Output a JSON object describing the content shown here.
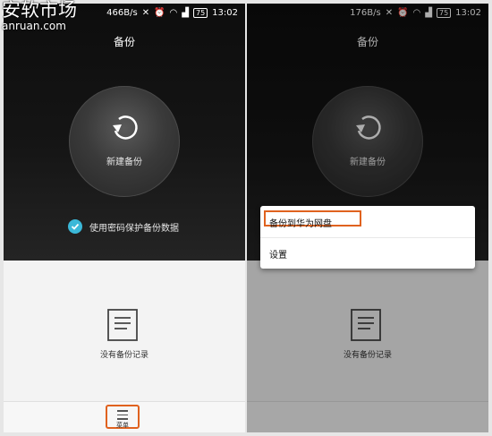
{
  "watermark": {
    "logo": "安软市场",
    "url": "anruan.com"
  },
  "left": {
    "status": {
      "speed": "466B/s",
      "battery": "75",
      "time": "13:02"
    },
    "title": "备份",
    "new_backup": "新建备份",
    "password_option": "使用密码保护备份数据",
    "password_checked": true,
    "empty_text": "没有备份记录",
    "menu_label": "菜单"
  },
  "right": {
    "status": {
      "speed": "176B/s",
      "battery": "75",
      "time": "13:02"
    },
    "title": "备份",
    "new_backup": "新建备份",
    "menu_items": [
      "备份到华为网盘",
      "设置"
    ],
    "empty_text": "没有备份记录"
  },
  "colors": {
    "highlight": "#e0621f",
    "check": "#3bb8d8"
  }
}
